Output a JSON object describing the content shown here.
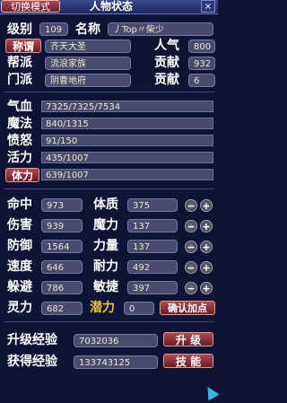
{
  "header": {
    "mode_button": "切换模式",
    "title": "人物状态",
    "corner": "×"
  },
  "profile": {
    "level_label": "级别",
    "level_value": "109",
    "name_label": "名称",
    "name_value": "丿Top〃柴少",
    "nickname_button": "称谓",
    "nickname_value": "齐天大圣",
    "popularity_label": "人气",
    "popularity_value": "800",
    "faction_label": "帮派",
    "faction_value": "流浪家族",
    "contribution_label": "贡献",
    "faction_contribution": "932",
    "sect_label": "门派",
    "sect_value": "阴曹地府",
    "sect_contribution_label": "贡献",
    "sect_contribution": "6"
  },
  "vitals": {
    "hp_label": "气血",
    "hp_value": "7325/7325/7534",
    "mp_label": "魔法",
    "mp_value": "840/1315",
    "anger_label": "愤怒",
    "anger_value": "91/150",
    "vigor_label": "活力",
    "vigor_value": "435/1007",
    "stamina_button": "体力",
    "stamina_value": "639/1007"
  },
  "combat": {
    "hit_label": "命中",
    "hit_value": "973",
    "damage_label": "伤害",
    "damage_value": "939",
    "defense_label": "防御",
    "defense_value": "1564",
    "speed_label": "速度",
    "speed_value": "646",
    "dodge_label": "躲避",
    "dodge_value": "786",
    "spirit_label": "灵力",
    "spirit_value": "682"
  },
  "attributes": {
    "physique_label": "体质",
    "physique_value": "375",
    "magic_label": "魔力",
    "magic_value": "137",
    "strength_label": "力量",
    "strength_value": "137",
    "endurance_label": "耐力",
    "endurance_value": "492",
    "agility_label": "敏捷",
    "agility_value": "397",
    "potential_label": "潜力",
    "potential_value": "0",
    "confirm_button": "确认加点"
  },
  "stepper": {
    "minus": "−",
    "plus": "+"
  },
  "experience": {
    "upgrade_label": "升级经验",
    "upgrade_value": "7032036",
    "upgrade_button": "升 级",
    "gained_label": "获得经验",
    "gained_value": "133743125",
    "skills_button": "技 能"
  }
}
